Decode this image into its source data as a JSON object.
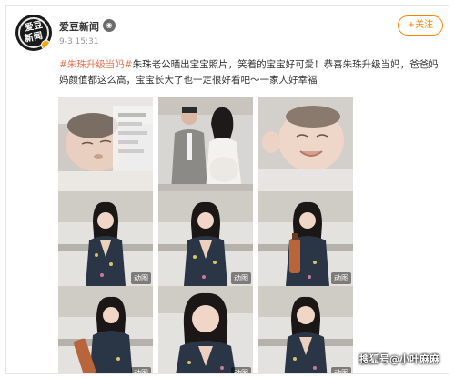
{
  "header": {
    "avatar_text_line1": "爱豆",
    "avatar_text_line2": "新闻",
    "username": "爱豆新闻",
    "badge_icon": "eye-badge-icon",
    "timestamp": "9-3 15:31",
    "follow_label": "+关注"
  },
  "post": {
    "hashtag": "#朱珠升级当妈#",
    "text": "朱珠老公晒出宝宝照片，笑着的宝宝好可爱！恭喜朱珠升级当妈，爸爸妈妈颜值都这么高，宝宝长大了也一定很好看吧～一家人好幸福"
  },
  "grid": {
    "animated_label": "动图",
    "items": [
      {
        "kind": "baby-sleeping",
        "animated": false
      },
      {
        "kind": "couple-photo",
        "animated": false
      },
      {
        "kind": "baby-smiling",
        "animated": false
      },
      {
        "kind": "woman-kitchen",
        "animated": true
      },
      {
        "kind": "woman-kitchen",
        "animated": true
      },
      {
        "kind": "woman-kitchen-bottle",
        "animated": true
      },
      {
        "kind": "woman-kitchen-bottle",
        "animated": true
      },
      {
        "kind": "woman-kitchen-closeup",
        "animated": true
      },
      {
        "kind": "woman-kitchen-smile",
        "animated": true
      }
    ]
  },
  "watermark": "搜狐号@小叶麻麻",
  "colors": {
    "follow_orange": "#ff8200",
    "hashtag_color": "#eb7350",
    "timestamp_gray": "#999999"
  }
}
